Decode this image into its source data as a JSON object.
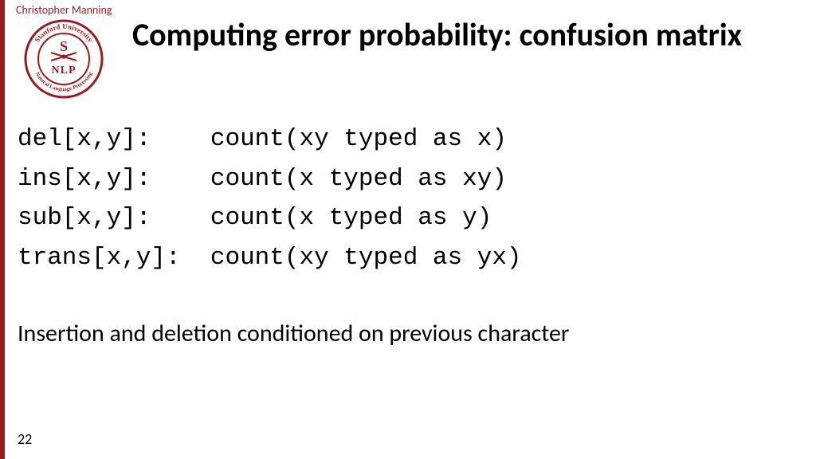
{
  "author": "Christopher Manning",
  "logo": {
    "top_text": "Stanford University",
    "mid_letters": "S",
    "nlp": "NLP",
    "bottom_text": "Natural Language Processing"
  },
  "title": "Computing error probability: confusion matrix",
  "definitions": [
    {
      "lhs": "del[x,y]:",
      "rhs": "count(xy typed as x)"
    },
    {
      "lhs": "ins[x,y]:",
      "rhs": "count(x typed as xy)"
    },
    {
      "lhs": "sub[x,y]:",
      "rhs": "count(x typed as y)"
    },
    {
      "lhs": "trans[x,y]:",
      "rhs": "count(xy typed as yx)"
    }
  ],
  "note": "Insertion and deletion conditioned on previous character",
  "page_number": "22"
}
